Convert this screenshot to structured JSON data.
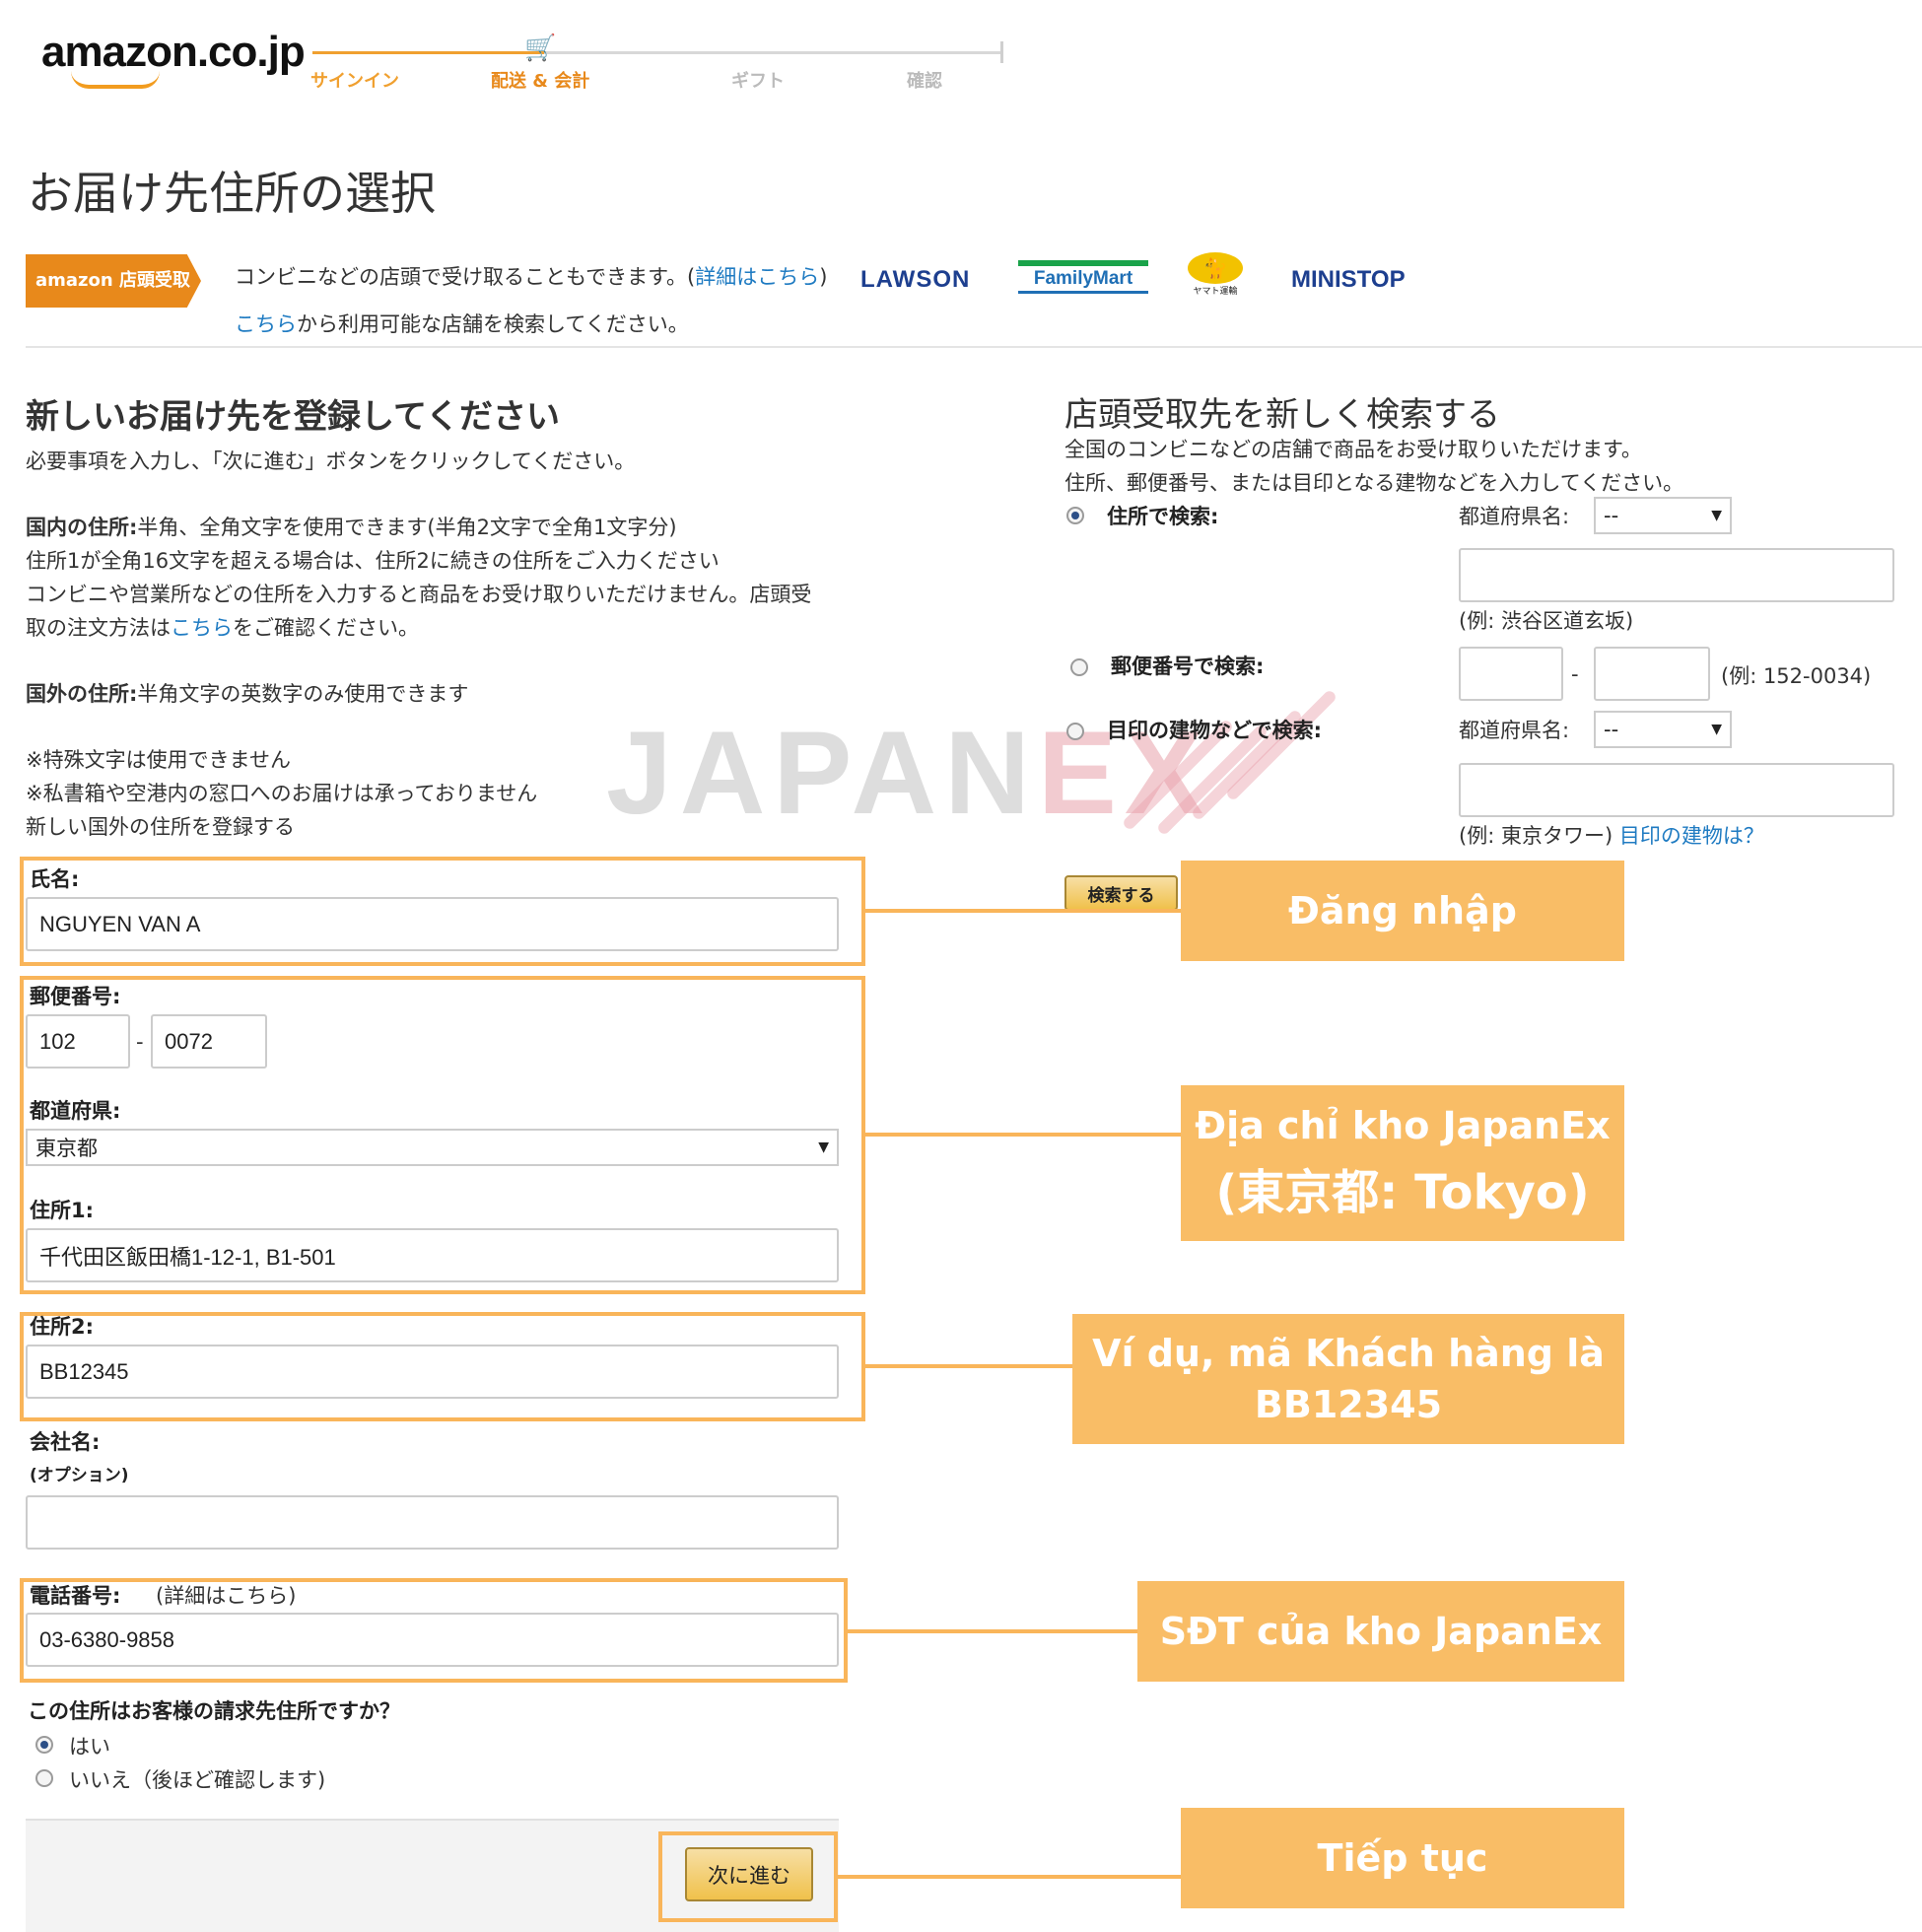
{
  "header": {
    "logo": "amazon.co.jp",
    "steps": [
      "サインイン",
      "配送 & 会計",
      "ギフト",
      "確認"
    ]
  },
  "page_title": "お届け先住所の選択",
  "store_pickup": {
    "badge": "amazon 店頭受取",
    "line1": "コンビニなどの店頭で受け取ることもできます。(",
    "line1_link": "詳細はこちら",
    "line1_end": ")",
    "line2_link": "こちら",
    "line2": "から利用可能な店舗を検索してください。",
    "brands": [
      "LAWSON",
      "FamilyMart",
      "ヤマト運輸",
      "MINISTOP"
    ]
  },
  "left": {
    "heading": "新しいお届け先を登録してください",
    "intro": "必要事項を入力し、「次に進む」ボタンをクリックしてください。",
    "domestic_label": "国内の住所:",
    "domestic_text": "半角、全角文字を使用できます(半角2文字で全角1文字分)",
    "domestic_line2": "住所1が全角16文字を超える場合は、住所2に続きの住所をご入力ください",
    "domestic_line3": "コンビニや営業所などの住所を入力すると商品をお受け取りいただけません。店頭受",
    "domestic_line4_a": "取の注文方法は",
    "domestic_line4_link": "こちら",
    "domestic_line4_b": "をご確認ください。",
    "foreign_label": "国外の住所:",
    "foreign_text": "半角文字の英数字のみ使用できます",
    "note1": "※特殊文字は使用できません",
    "note2": "※私書箱や空港内の窓口へのお届けは承っておりません",
    "foreign_link": "新しい国外の住所を登録する"
  },
  "form": {
    "name_label": "氏名:",
    "name_value": "NGUYEN VAN A",
    "postal_label": "郵便番号:",
    "postal1": "102",
    "postal_dash": "-",
    "postal2": "0072",
    "pref_label": "都道府県:",
    "pref_value": "東京都",
    "addr1_label": "住所1:",
    "addr1_value": "千代田区飯田橋1-12-1, B1-501",
    "addr2_label": "住所2:",
    "addr2_value": "BB12345",
    "company_label": "会社名:",
    "company_note": "(オプション)",
    "company_value": "",
    "phone_label": "電話番号:",
    "phone_link": "(詳細はこちら)",
    "phone_value": "03-6380-9858",
    "billing_question": "この住所はお客様の請求先住所ですか？",
    "billing_yes": "はい",
    "billing_no": "いいえ（後ほど確認します)",
    "next_button": "次に進む"
  },
  "right": {
    "heading": "店頭受取先を新しく検索する",
    "desc1": "全国のコンビニなどの店舗で商品をお受け取りいただけます。",
    "desc2": "住所、郵便番号、または目印となる建物などを入力してください。",
    "by_address": "住所で検索:",
    "pref_label": "都道府県名:",
    "pref_value": "--",
    "address_example": "(例: 渋谷区道玄坂)",
    "by_postal": "郵便番号で検索:",
    "postal_dash": "-",
    "postal_example": "(例: 152-0034)",
    "by_landmark": "目印の建物などで検索:",
    "pref_label2": "都道府県名:",
    "pref_value2": "--",
    "landmark_example": "(例: 東京タワー)",
    "landmark_link": "目印の建物は？",
    "search_button": "検索する"
  },
  "watermark": {
    "a": "JAPAN",
    "b": "EX"
  },
  "callouts": {
    "login": "Đăng nhập",
    "warehouse_line1": "Địa chỉ kho JapanEx",
    "warehouse_line2": "(東京都: Tokyo)",
    "customer_line1": "Ví dụ, mã Khách hàng là",
    "customer_line2": "BB12345",
    "phone": "SĐT của kho JapanEx",
    "continue": "Tiếp tục"
  },
  "colors": {
    "accent_orange": "#f9bd66",
    "link_blue": "#1f7bc2",
    "badge_orange": "#e8891b"
  }
}
